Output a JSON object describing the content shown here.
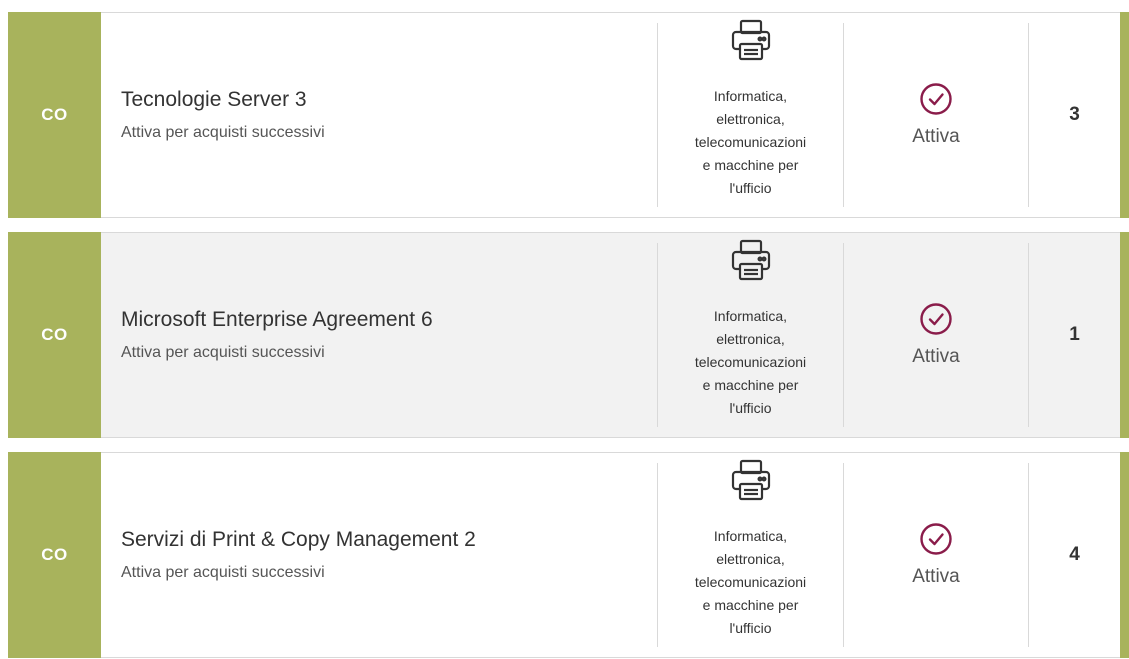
{
  "colors": {
    "accent": "#a8b35c",
    "status": "#8a1c4a",
    "row_alt_bg": "#f2f2f2"
  },
  "rows": [
    {
      "type": "CO",
      "title": "Tecnologie Server 3",
      "subtitle": "Attiva per acquisti successivi",
      "category_icon": "printer-icon",
      "category_lines": [
        "Informatica,",
        "elettronica,",
        "telecomunicazioni",
        "e macchine per",
        "l'ufficio"
      ],
      "status_icon": "check-circle-icon",
      "status": "Attiva",
      "count": "3"
    },
    {
      "type": "CO",
      "title": "Microsoft Enterprise Agreement 6",
      "subtitle": "Attiva per acquisti successivi",
      "category_icon": "printer-icon",
      "category_lines": [
        "Informatica,",
        "elettronica,",
        "telecomunicazioni",
        "e macchine per",
        "l'ufficio"
      ],
      "status_icon": "check-circle-icon",
      "status": "Attiva",
      "count": "1"
    },
    {
      "type": "CO",
      "title": "Servizi di Print & Copy Management 2",
      "subtitle": "Attiva per acquisti successivi",
      "category_icon": "printer-icon",
      "category_lines": [
        "Informatica,",
        "elettronica,",
        "telecomunicazioni",
        "e macchine per",
        "l'ufficio"
      ],
      "status_icon": "check-circle-icon",
      "status": "Attiva",
      "count": "4"
    }
  ]
}
